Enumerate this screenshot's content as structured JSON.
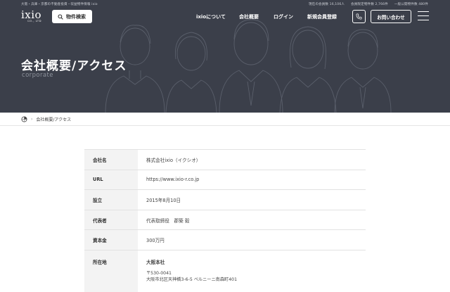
{
  "header": {
    "tagline": "大阪・兵庫・京都の不動産投資・収益物件情報 ixio",
    "stats": [
      "現在の会員数 16,106人",
      "会員限定物件数 2,766件",
      "一般公開物件数 480件"
    ],
    "logo_main": "ixio",
    "logo_sub": "CO., LTD",
    "search_label": "物件検索",
    "nav": [
      "ixioについて",
      "会社概要",
      "ログイン",
      "新規会員登録"
    ],
    "contact_label": "お問い合わせ"
  },
  "hero": {
    "title": "会社概要/アクセス",
    "subtitle": "corporate"
  },
  "breadcrumb": {
    "current": "会社概要/アクセス"
  },
  "company": {
    "rows": [
      {
        "label": "会社名",
        "value": "株式会社ixio（イクシオ）"
      },
      {
        "label": "URL",
        "value": "https://www.ixio-r.co.jp"
      },
      {
        "label": "設立",
        "value": "2015年8月10日"
      },
      {
        "label": "代表者",
        "value": "代表取締役　郡築 毅"
      },
      {
        "label": "資本金",
        "value": "300万円"
      }
    ],
    "address": {
      "label": "所在地",
      "name": "大阪本社",
      "postal": "〒530-0041",
      "line": "大阪市北区天神橋3-6-5 ベルニーニ南森町401"
    }
  },
  "colors": {
    "hero_bg": "#3b3f4a",
    "label_bg": "#f3f3f3",
    "text": "#333333"
  }
}
